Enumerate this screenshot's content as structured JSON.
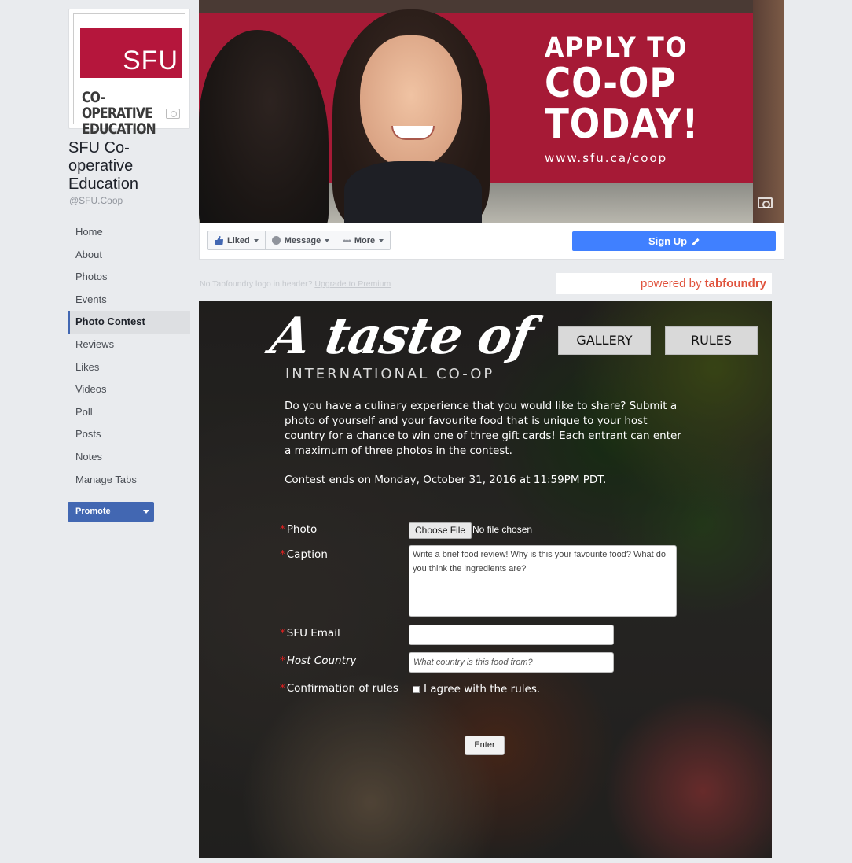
{
  "page": {
    "name": "SFU Co-operative Education",
    "handle": "@SFU.Coop",
    "logo": {
      "brand": "SFU",
      "text": "CO-OPERATIVE EDUCATION"
    }
  },
  "nav": {
    "items": [
      {
        "label": "Home"
      },
      {
        "label": "About"
      },
      {
        "label": "Photos"
      },
      {
        "label": "Events"
      },
      {
        "label": "Photo Contest",
        "active": true
      },
      {
        "label": "Reviews"
      },
      {
        "label": "Likes"
      },
      {
        "label": "Videos"
      },
      {
        "label": "Poll"
      },
      {
        "label": "Posts"
      },
      {
        "label": "Notes"
      },
      {
        "label": "Manage Tabs"
      }
    ],
    "promote_label": "Promote"
  },
  "cover": {
    "line1": "APPLY TO",
    "line2": "CO-OP",
    "line3": "TODAY!",
    "url": "www.sfu.ca/coop"
  },
  "action_bar": {
    "liked_label": "Liked",
    "message_label": "Message",
    "more_label": "More",
    "signup_label": "Sign Up"
  },
  "tabfoundry": {
    "note": "No Tabfoundry logo in header?",
    "upgrade_link": "Upgrade to Premium",
    "powered_prefix": "powered by",
    "powered_brand": "tabfoundry"
  },
  "contest": {
    "title_script": "A taste of",
    "title_sub": "INTERNATIONAL CO-OP",
    "gallery_label": "GALLERY",
    "rules_label": "RULES",
    "intro": "Do you have a culinary experience that you would like to share? Submit a photo of yourself and your favourite food that is unique to your host country for a chance to win one of three gift cards! Each entrant can enter a maximum of three photos in the contest.",
    "deadline": "Contest ends on Monday, October 31, 2016 at 11:59PM PDT.",
    "form": {
      "photo_label": "Photo",
      "choose_file_label": "Choose File",
      "file_status": "No file chosen",
      "caption_label": "Caption",
      "caption_placeholder": "Write a brief food review! Why is this your favourite food? What do you think the ingredients are?",
      "email_label": "SFU Email",
      "email_value": "",
      "country_label": "Host Country",
      "country_placeholder": "What country is this food from?",
      "rules_label": "Confirmation of rules",
      "agree_label": "I agree with the rules.",
      "enter_label": "Enter",
      "required_mark": "*"
    }
  }
}
